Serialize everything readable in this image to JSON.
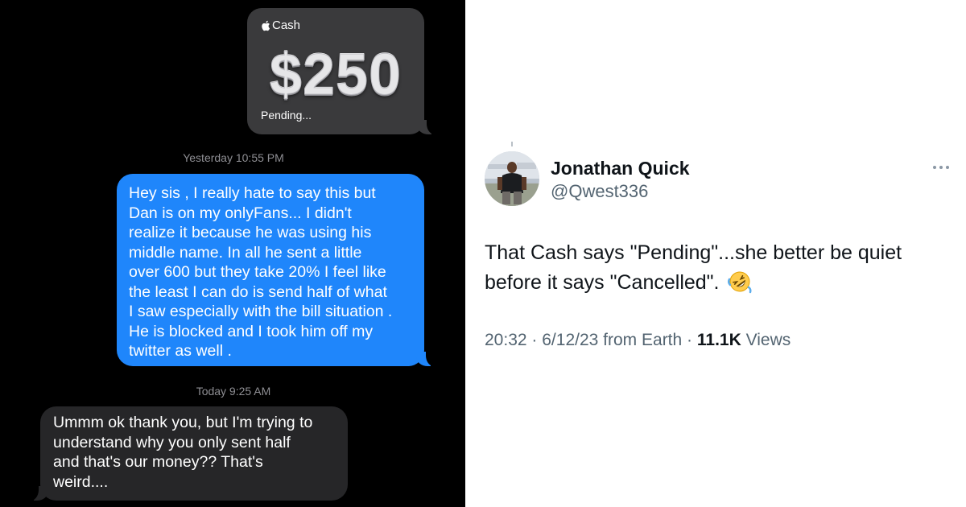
{
  "imessage": {
    "cash_card": {
      "brand": "Cash",
      "amount": "$250",
      "status": "Pending..."
    },
    "timestamp_1": "Yesterday 10:55 PM",
    "outgoing_message_lines": [
      "Hey sis , I really hate to say this but",
      "Dan is on my onlyFans... I didn't",
      "realize it because he was using his",
      "middle name. In all he sent a little",
      "over 600 but they take 20% I feel like",
      "the least I can do is send half of what",
      "I saw especially with the bill situation .",
      "He is blocked and I took him off my",
      "twitter as well ."
    ],
    "timestamp_2": "Today 9:25 AM",
    "incoming_message_lines": [
      "Ummm ok thank you, but I'm trying to",
      "understand why you only sent half",
      "and that's our money?? That's",
      "weird...."
    ],
    "colors": {
      "background": "#000000",
      "outgoing_bubble": "#1f86fb",
      "incoming_bubble": "#262628",
      "cash_bubble": "#3a3a3c"
    }
  },
  "tweet": {
    "display_name": "Jonathan Quick",
    "handle": "@Qwest336",
    "text": "That Cash says \"Pending\"...she better be quiet before it says \"Cancelled\".",
    "emoji": "rolling-on-floor-laughing",
    "time": "20:32",
    "date": "6/12/23",
    "source": "from Earth",
    "views_count": "11.1K",
    "views_label": "Views",
    "separator": "·",
    "more_icon": "more-horizontal-icon",
    "colors": {
      "primary_text": "#0f1419",
      "secondary_text": "#536471"
    }
  }
}
